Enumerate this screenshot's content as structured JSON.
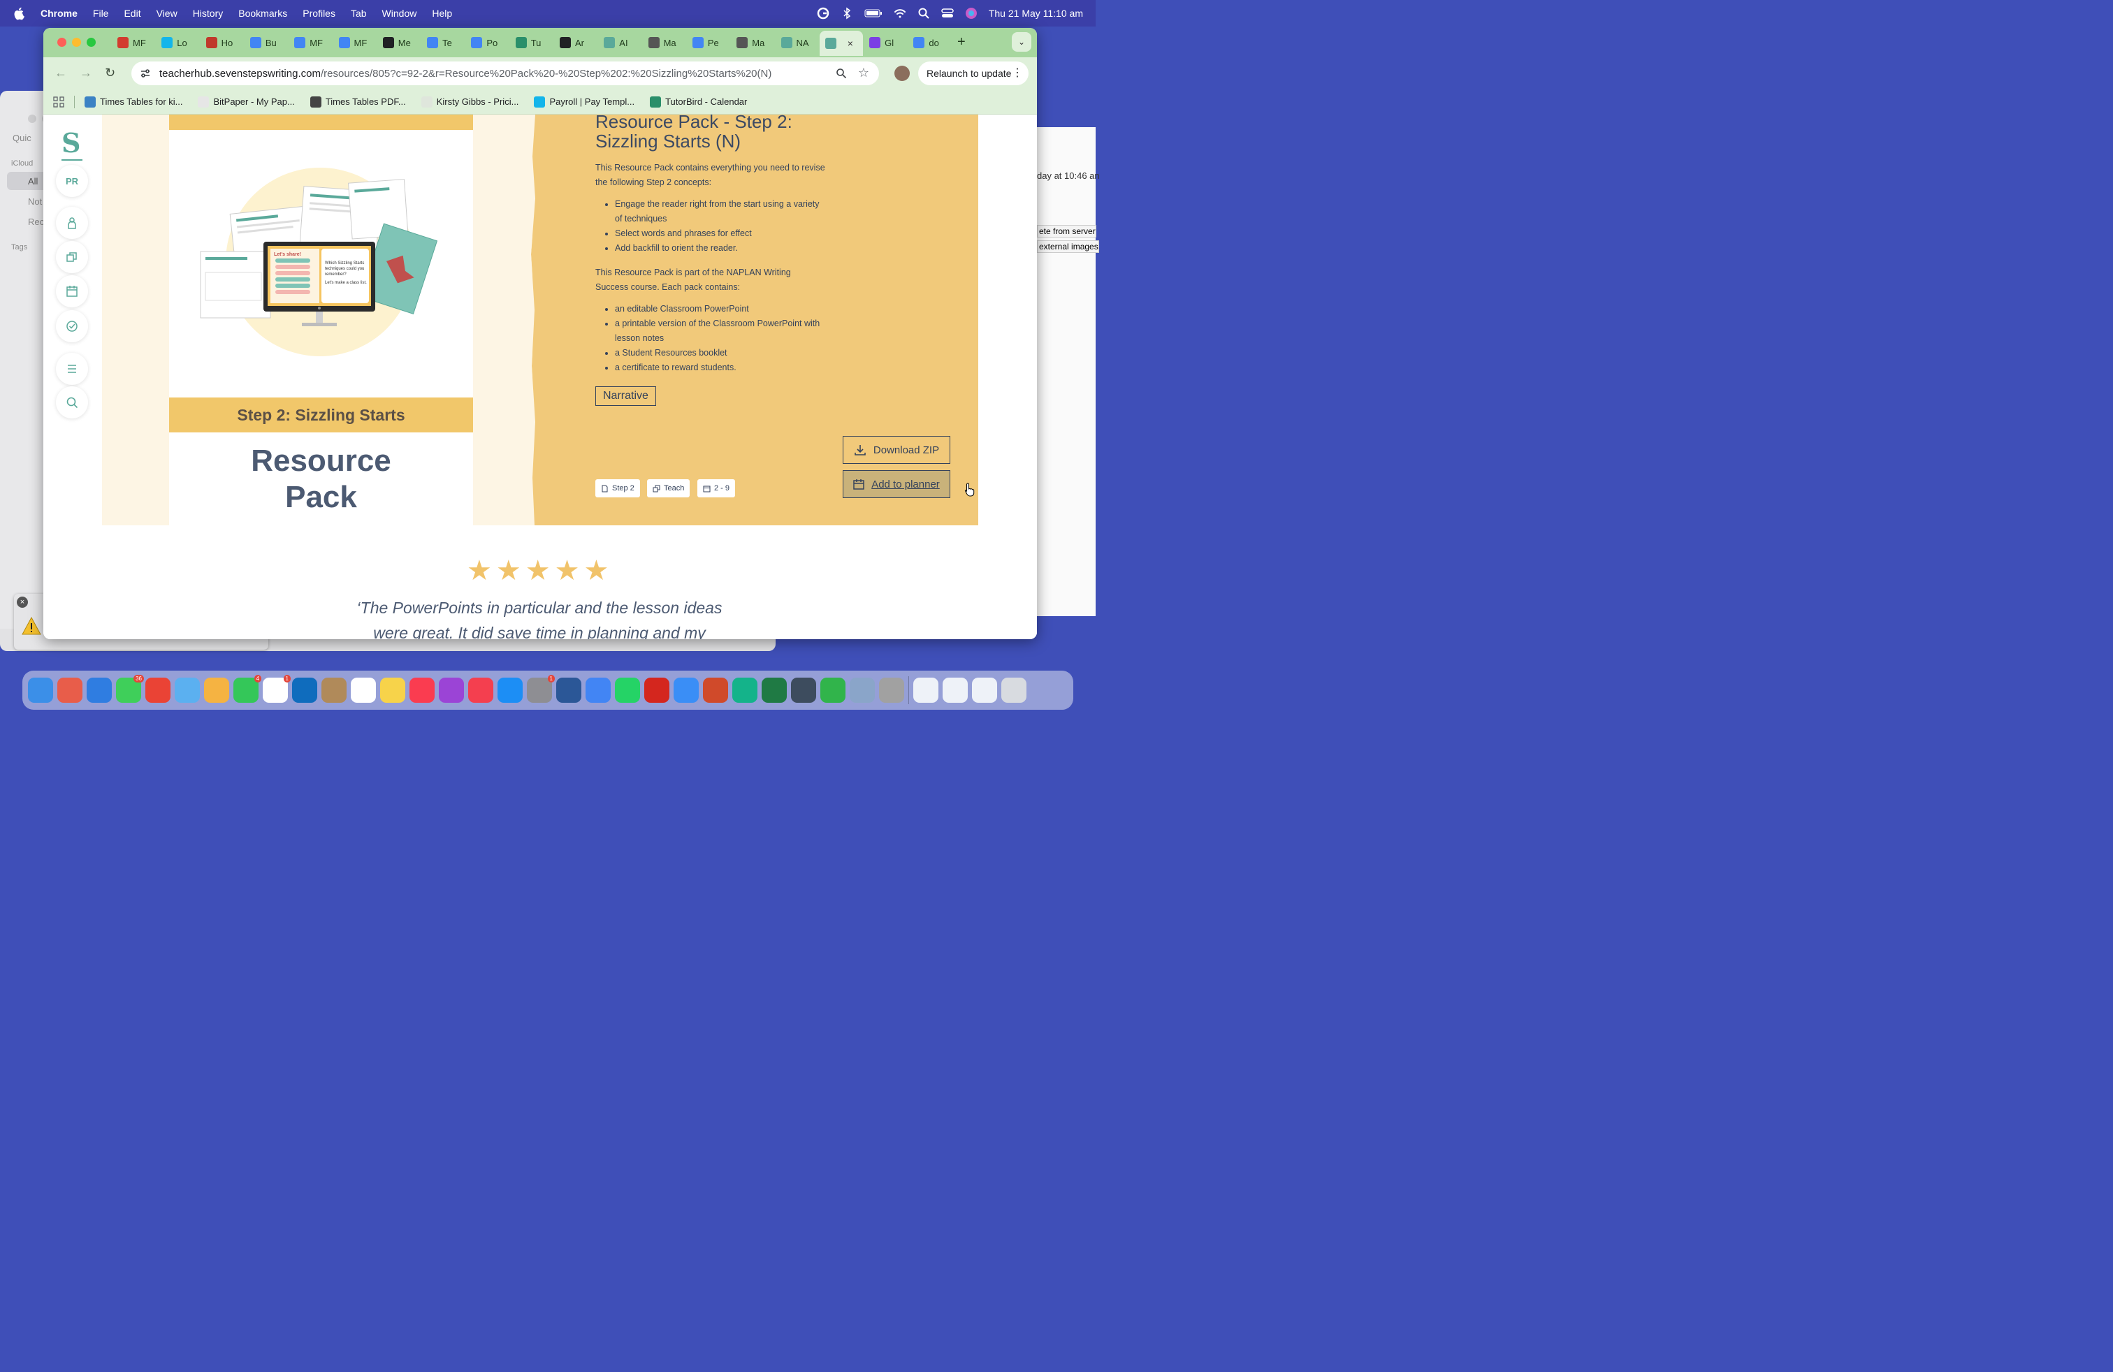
{
  "menubar": {
    "items": [
      "Chrome",
      "File",
      "Edit",
      "View",
      "History",
      "Bookmarks",
      "Profiles",
      "Tab",
      "Window",
      "Help"
    ],
    "clock": "Thu 21 May  11:10 am"
  },
  "background_windows": {
    "notes_sidebar": [
      "Quic",
      "iCloud",
      "All",
      "Not",
      "Rec",
      "Tags"
    ],
    "mail_texts": [
      "day at 10:46 an",
      "ete from server",
      "external images"
    ]
  },
  "tabs": [
    {
      "label": "MF",
      "color": "#d23b2e"
    },
    {
      "label": "Lo",
      "color": "#13b5ea"
    },
    {
      "label": "Ho",
      "color": "#c0392b"
    },
    {
      "label": "Bu",
      "color": "#4285f4"
    },
    {
      "label": "MF",
      "color": "#4285f4"
    },
    {
      "label": "MF",
      "color": "#4285f4"
    },
    {
      "label": "Me",
      "color": "#202124"
    },
    {
      "label": "Te",
      "color": "#4285f4"
    },
    {
      "label": "Po",
      "color": "#4285f4"
    },
    {
      "label": "Tu",
      "color": "#2a8f6a"
    },
    {
      "label": "Ar",
      "color": "#202124"
    },
    {
      "label": "AI",
      "color": "#5aa99a"
    },
    {
      "label": "Ma",
      "color": "#555"
    },
    {
      "label": "Pe",
      "color": "#4285f4"
    },
    {
      "label": "Ma",
      "color": "#555"
    },
    {
      "label": "NA",
      "color": "#5aa99a"
    },
    {
      "label": "",
      "color": "#5aa99a",
      "active": true
    },
    {
      "label": "Gl",
      "color": "#7b3fe4"
    },
    {
      "label": "do",
      "color": "#4285f4"
    }
  ],
  "omnibox": {
    "host": "teacherhub.sevenstepswriting.com",
    "path": "/resources/805?c=92-2&r=Resource%20Pack%20-%20Step%202:%20Sizzling%20Starts%20(N)"
  },
  "relaunch_label": "Relaunch to update",
  "bookmarks": [
    {
      "label": "Times Tables for ki...",
      "color": "#3b82c4"
    },
    {
      "label": "BitPaper - My Pap...",
      "color": "#e6e6e6"
    },
    {
      "label": "Times Tables PDF...",
      "color": "#444"
    },
    {
      "label": "Kirsty Gibbs - Prici...",
      "color": "#dfe6dc"
    },
    {
      "label": "Payroll | Pay Templ...",
      "color": "#13b5ea"
    },
    {
      "label": "TutorBird - Calendar",
      "color": "#2a8f6a"
    }
  ],
  "sidebar": {
    "logo": "S",
    "profile_initials": "PR"
  },
  "resource": {
    "title": "Resource Pack - Step 2: Sizzling Starts (N)",
    "intro": "This Resource Pack contains everything you need to revise the following Step 2 concepts:",
    "concepts": [
      "Engage the reader right from the start using a variety of techniques",
      "Select words and phrases for effect",
      "Add backfill to orient the reader."
    ],
    "course_text": "This Resource Pack is part of the NAPLAN Writing Success course. Each pack contains:",
    "contents": [
      "an editable Classroom PowerPoint",
      "a printable version of the Classroom PowerPoint with lesson notes",
      "a Student Resources booklet",
      "a certificate to reward students."
    ],
    "genre_tag": "Narrative",
    "meta": {
      "step": "Step 2",
      "type": "Teach",
      "years": "2 - 9"
    },
    "download_label": "Download ZIP",
    "planner_label": "Add to planner",
    "cover": {
      "band_text": "Step 2: Sizzling Starts",
      "title_line1": "Resource",
      "title_line2": "Pack",
      "screen_heading": "Let's share!",
      "screen_question": "Which Sizzling Starts techniques could you remember? Let's make a class list."
    }
  },
  "testimonial": {
    "rating": 5,
    "quote_line1": "‘The PowerPoints in particular and the lesson ideas",
    "quote_line2": "were great. It did save time in planning and my"
  },
  "dock": {
    "apps": [
      {
        "name": "finder",
        "color": "#3b8fe8"
      },
      {
        "name": "launchpad",
        "color": "#e85d4a"
      },
      {
        "name": "safari",
        "color": "#2f7de1"
      },
      {
        "name": "messages",
        "color": "#3fcf5a",
        "badge": "36"
      },
      {
        "name": "chrome",
        "color": "#ea4335"
      },
      {
        "name": "maps",
        "color": "#5bb0f0"
      },
      {
        "name": "photos",
        "color": "#f5b342"
      },
      {
        "name": "facetime",
        "color": "#34c759",
        "badge": "4"
      },
      {
        "name": "calendar",
        "color": "#ffffff",
        "badge": "1"
      },
      {
        "name": "outlook",
        "color": "#0f6cbd"
      },
      {
        "name": "contacts",
        "color": "#b08a5a"
      },
      {
        "name": "reminders",
        "color": "#ffffff"
      },
      {
        "name": "notes",
        "color": "#f7d34a"
      },
      {
        "name": "music",
        "color": "#fa3c50"
      },
      {
        "name": "podcasts",
        "color": "#9b44d6"
      },
      {
        "name": "news",
        "color": "#f43f4f"
      },
      {
        "name": "app-store",
        "color": "#1c8ef5"
      },
      {
        "name": "system-settings",
        "color": "#8e8e93",
        "badge": "1"
      },
      {
        "name": "word",
        "color": "#2b5797"
      },
      {
        "name": "google-calendar",
        "color": "#4285f4"
      },
      {
        "name": "whatsapp",
        "color": "#25d366"
      },
      {
        "name": "acrobat",
        "color": "#d4261e"
      },
      {
        "name": "mail",
        "color": "#3a8ef6"
      },
      {
        "name": "powerpoint",
        "color": "#d04a2a"
      },
      {
        "name": "grammarly",
        "color": "#14b38a"
      },
      {
        "name": "excel",
        "color": "#1f7a44"
      },
      {
        "name": "preview",
        "color": "#3d4c5e"
      },
      {
        "name": "numbers",
        "color": "#31b44b"
      },
      {
        "name": "migration",
        "color": "#8aa5c9"
      },
      {
        "name": "utility",
        "color": "#a1a1a1"
      }
    ],
    "recents": [
      {
        "name": "recent-window-1",
        "color": "#eef2f8"
      },
      {
        "name": "recent-window-2",
        "color": "#eef2f8"
      },
      {
        "name": "recent-window-3",
        "color": "#eef2f8"
      },
      {
        "name": "trash",
        "color": "#d8dbe0"
      }
    ]
  }
}
